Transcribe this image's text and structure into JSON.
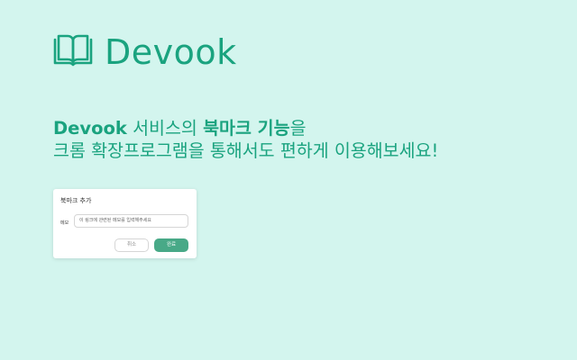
{
  "brand": {
    "name": "Devook",
    "accent_color": "#1aa37f",
    "logo_icon": "open-book-icon"
  },
  "headline": {
    "line1_brand": "Devook",
    "line1_a": " 서비스의 ",
    "line1_bold": "북마크 기능",
    "line1_b": "을",
    "line2": "크롬 확장프로그램을 통해서도 편하게 이용해보세요!"
  },
  "dialog": {
    "title": "북마크 추가",
    "memo_label": "메모",
    "memo_placeholder": "이 링크에 관련된 메모를 입력해주세요",
    "cancel_label": "취소",
    "done_label": "완료"
  },
  "colors": {
    "background": "#d3f5ee",
    "button_primary": "#48a987"
  }
}
